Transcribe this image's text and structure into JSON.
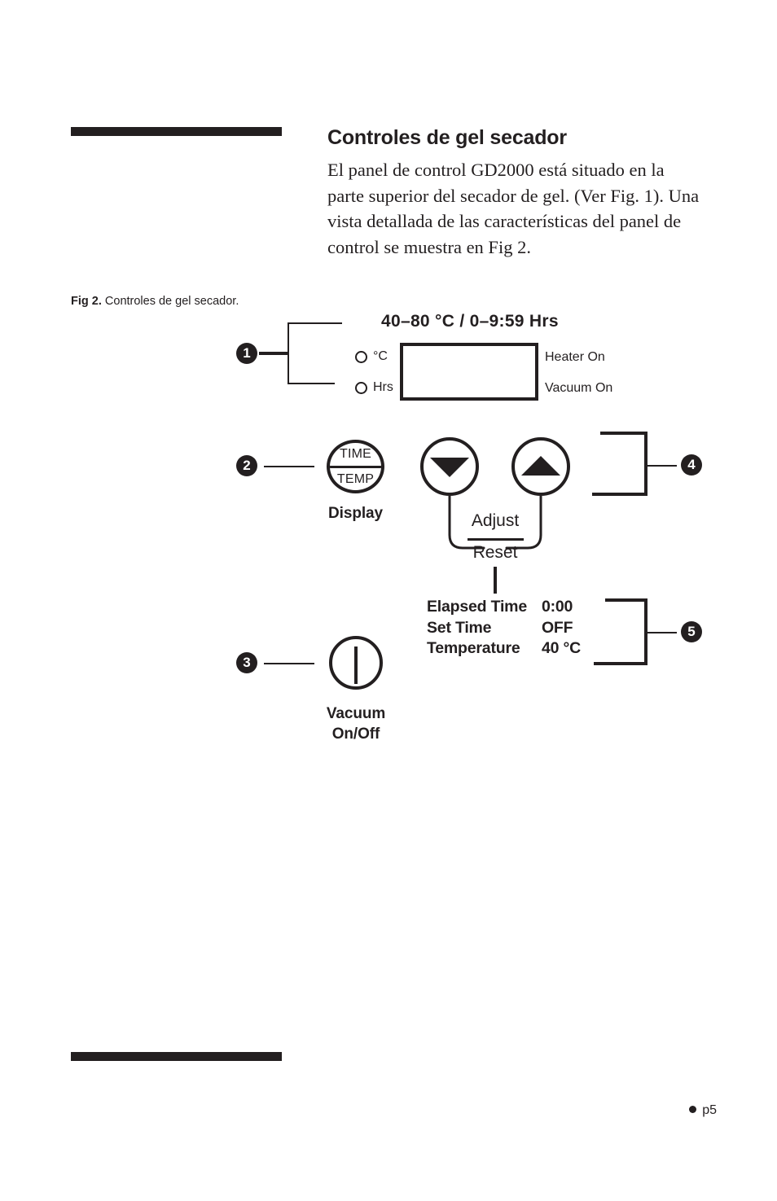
{
  "section": {
    "heading": "Controles de gel secador",
    "body": "El panel de control GD2000 está situado en la parte superior del secador de gel. (Ver Fig. 1). Una vista detallada de las características del panel de control se muestra en Fig 2."
  },
  "figure": {
    "caption_label": "Fig 2.",
    "caption_text": "Controles de gel secador.",
    "range_label": "40–80 °C / 0–9:59 Hrs",
    "indicators": [
      {
        "label": "°C"
      },
      {
        "label": "Hrs"
      }
    ],
    "status_lights": [
      {
        "label": "Heater On"
      },
      {
        "label": "Vacuum On"
      }
    ],
    "buttons": {
      "display": {
        "top_text": "TIME",
        "bottom_text": "TEMP",
        "caption": "Display"
      },
      "down": {
        "icon": "triangle-down-icon"
      },
      "up": {
        "icon": "triangle-up-icon"
      },
      "adjust_reset": {
        "numerator": "Adjust",
        "denominator": "Reset"
      },
      "vacuum": {
        "caption_line1": "Vacuum",
        "caption_line2": "On/Off"
      }
    },
    "readout": {
      "rows": [
        {
          "key": "Elapsed Time",
          "value": "0:00"
        },
        {
          "key": "Set Time",
          "value": "OFF"
        },
        {
          "key": "Temperature",
          "value": "40 °C"
        }
      ]
    },
    "callouts": [
      {
        "number": "1"
      },
      {
        "number": "2"
      },
      {
        "number": "3"
      },
      {
        "number": "4"
      },
      {
        "number": "5"
      }
    ]
  },
  "footer": {
    "page_label": "p5"
  },
  "colors": {
    "ink": "#231f20",
    "paper": "#ffffff"
  }
}
